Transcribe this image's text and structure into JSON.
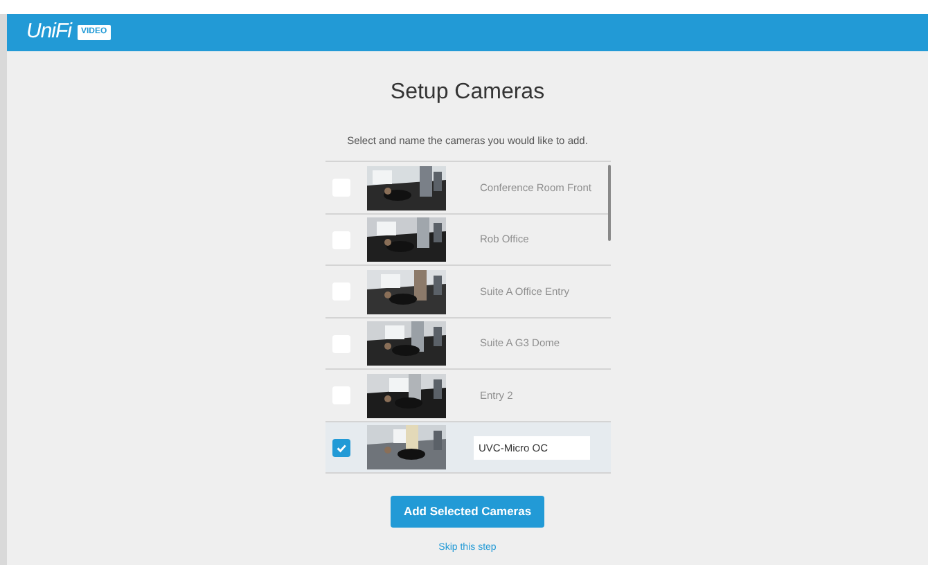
{
  "header": {
    "logo": "UniFi",
    "badge": "VIDEO"
  },
  "title": "Setup Cameras",
  "subtitle": "Select and name the cameras you would like to add.",
  "cameras": [
    {
      "name": "Conference Room Front",
      "checked": false
    },
    {
      "name": "Rob Office",
      "checked": false
    },
    {
      "name": "Suite A Office Entry",
      "checked": false
    },
    {
      "name": "Suite A G3 Dome",
      "checked": false
    },
    {
      "name": "Entry 2",
      "checked": false
    },
    {
      "name": "UVC-Micro OC",
      "checked": true
    }
  ],
  "add_button": "Add Selected Cameras",
  "skip_link": "Skip this step"
}
